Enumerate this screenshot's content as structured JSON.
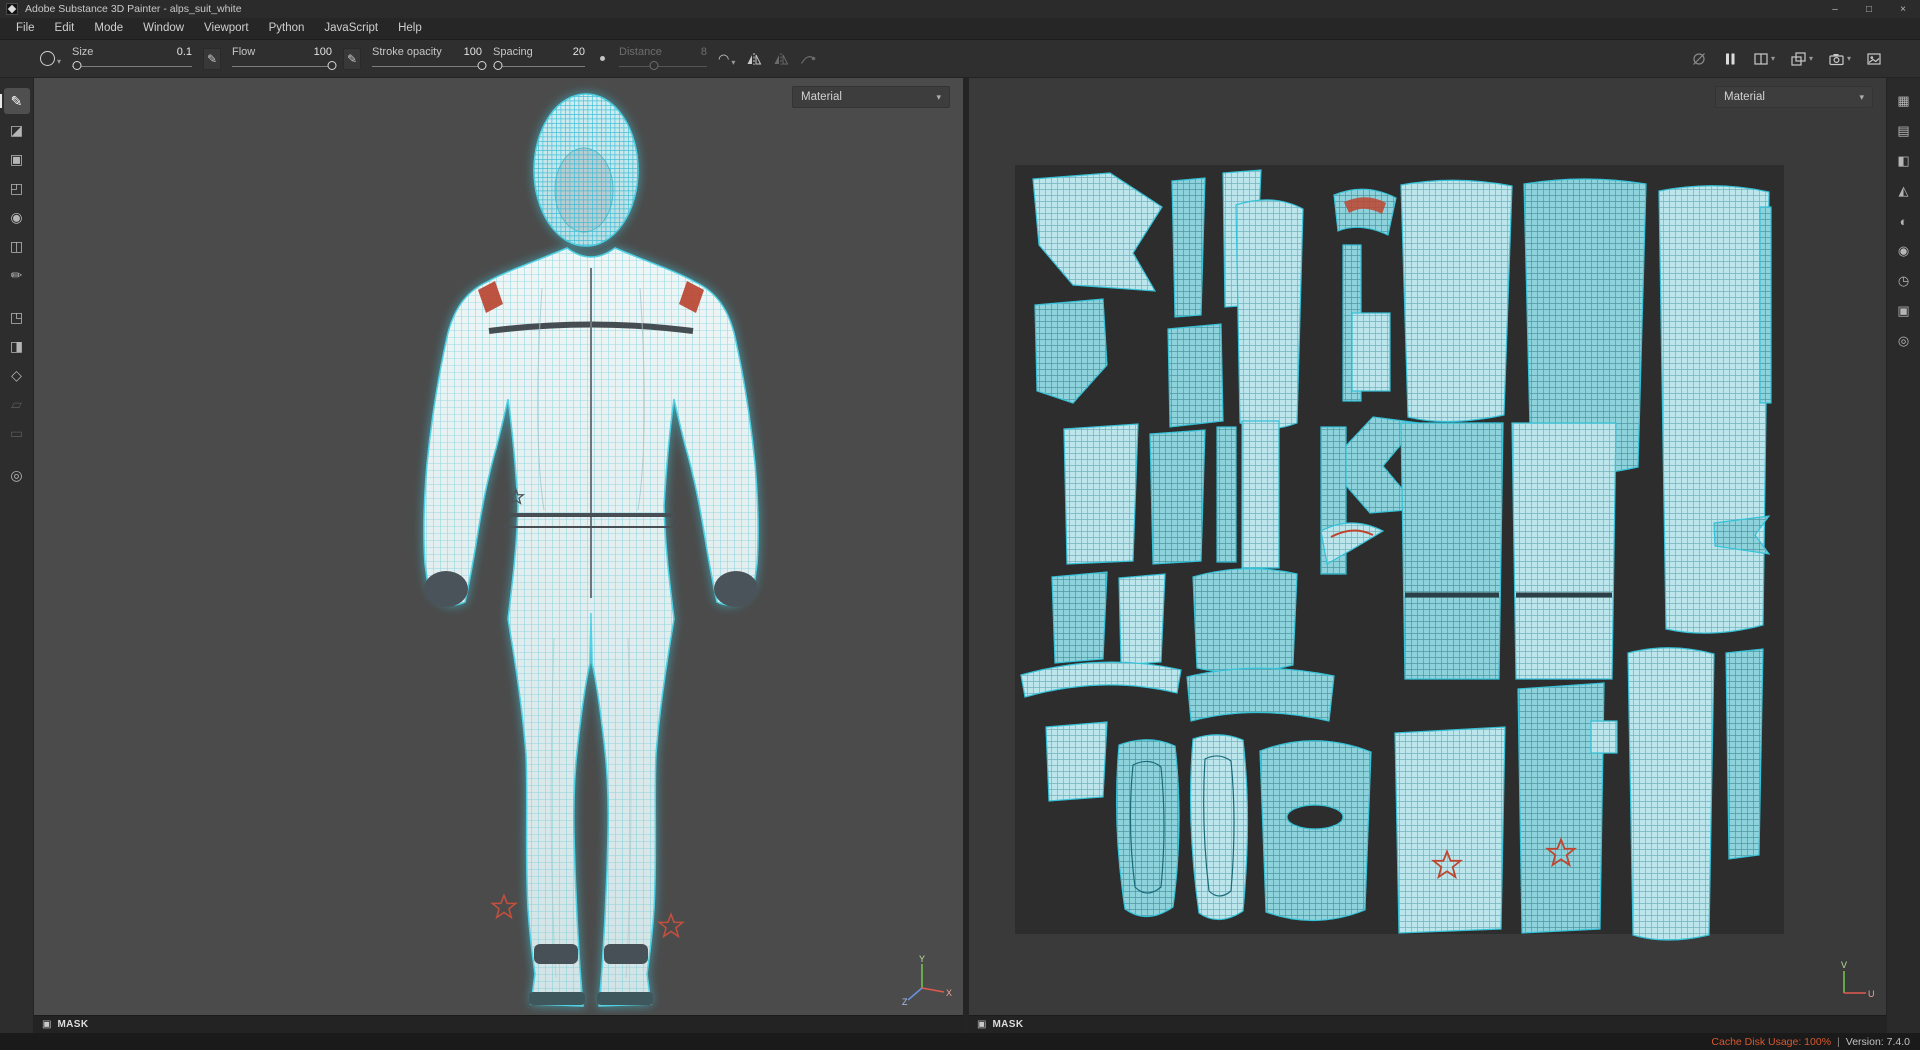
{
  "window": {
    "title": "Adobe Substance 3D Painter - alps_suit_white",
    "minimize": "–",
    "maximize": "□",
    "close": "×"
  },
  "menu": {
    "items": [
      {
        "label": "File"
      },
      {
        "label": "Edit"
      },
      {
        "label": "Mode"
      },
      {
        "label": "Window"
      },
      {
        "label": "Viewport"
      },
      {
        "label": "Python"
      },
      {
        "label": "JavaScript"
      },
      {
        "label": "Help"
      }
    ]
  },
  "toolbar": {
    "brush_preview_chevron": "▾",
    "pen_icon": "✎",
    "falloff_icon": "◠",
    "falloff_chevron": "▾",
    "sliders": [
      {
        "label": "Size",
        "value": "0.1",
        "percent": 4
      },
      {
        "label": "Flow",
        "value": "100",
        "percent": 100
      },
      {
        "label": "Stroke opacity",
        "value": "100",
        "percent": 100
      },
      {
        "label": "Spacing",
        "value": "20",
        "percent": 5
      },
      {
        "label": "Distance",
        "value": "8",
        "percent": 40,
        "state": "disabled"
      }
    ]
  },
  "tools": {
    "items": [
      {
        "name": "paint",
        "glyph": "✎",
        "state": "active"
      },
      {
        "name": "eraser",
        "glyph": "◪"
      },
      {
        "name": "projection",
        "glyph": "▣"
      },
      {
        "name": "polygon-fill",
        "glyph": "◰"
      },
      {
        "name": "smudge",
        "glyph": "◉"
      },
      {
        "name": "clone",
        "glyph": "◫"
      },
      {
        "name": "material-picker",
        "glyph": "✏"
      },
      {
        "name": "export",
        "glyph": "◳"
      },
      {
        "name": "geometry-mask",
        "glyph": "◨"
      },
      {
        "name": "smart-material",
        "glyph": "◇"
      },
      {
        "name": "particles",
        "glyph": "▱",
        "state": "disabled"
      },
      {
        "name": "symmetry-tool",
        "glyph": "▭",
        "state": "disabled"
      },
      {
        "name": "effects",
        "glyph": "◎"
      }
    ]
  },
  "panels": {
    "items": [
      {
        "name": "texture-set-list",
        "glyph": "▦"
      },
      {
        "name": "layers",
        "glyph": "▤"
      },
      {
        "name": "texture-set-settings",
        "glyph": "◧"
      },
      {
        "name": "shader-settings",
        "glyph": "◭"
      },
      {
        "name": "display-settings",
        "glyph": "◐"
      },
      {
        "name": "viewer-settings",
        "glyph": "◉"
      },
      {
        "name": "history",
        "glyph": "◷"
      },
      {
        "name": "log",
        "glyph": "▣"
      },
      {
        "name": "properties",
        "glyph": "◎"
      }
    ]
  },
  "viewport3d": {
    "material": "Material",
    "select_chevron": "▾",
    "mask_icon": "▣",
    "mask": "MASK",
    "axes": {
      "x": "X",
      "y": "Y",
      "z": "Z"
    }
  },
  "viewport2d": {
    "material": "Material",
    "select_chevron": "▾",
    "mask_icon": "▣",
    "mask": "MASK",
    "axes": {
      "u": "U",
      "v": "V"
    }
  },
  "status": {
    "cache": "Cache Disk Usage: 100%",
    "sep": "|",
    "version": "Version: 7.4.0"
  },
  "colors": {
    "accent_cyan": "#3fc8de",
    "accent_red": "#c0452f",
    "status_warning": "#d9582e",
    "viewport_bg_3d": "#4b4b4b",
    "viewport_bg_2d": "#3a3a3a"
  }
}
